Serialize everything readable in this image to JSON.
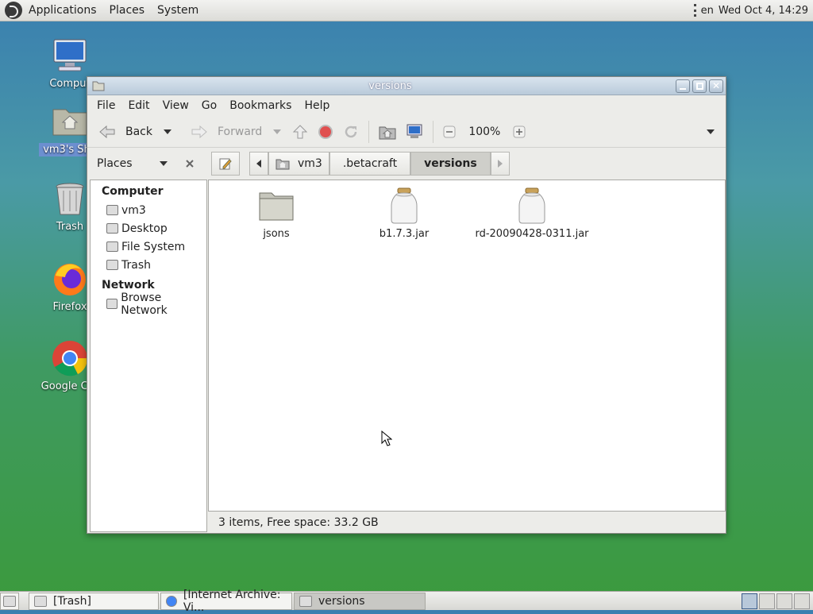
{
  "top_panel": {
    "menus": [
      "Applications",
      "Places",
      "System"
    ],
    "language": "en",
    "clock": "Wed Oct 4, 14:29"
  },
  "desktop": {
    "icons": [
      {
        "label": "Comput",
        "icon": "computer-icon"
      },
      {
        "label": "vm3's Sha",
        "icon": "home-folder-icon",
        "selected": true
      },
      {
        "label": "Trash",
        "icon": "trash-icon"
      },
      {
        "label": "Firefox",
        "icon": "firefox-icon"
      },
      {
        "label": "Google Chr",
        "icon": "chrome-icon"
      }
    ]
  },
  "window": {
    "title": "versions",
    "menus": [
      "File",
      "Edit",
      "View",
      "Go",
      "Bookmarks",
      "Help"
    ],
    "toolbar": {
      "back": "Back",
      "forward": "Forward",
      "zoom": "100%"
    },
    "sidebar": {
      "selector": "Places",
      "categories": [
        {
          "title": "Computer",
          "items": [
            "vm3",
            "Desktop",
            "File System",
            "Trash"
          ]
        },
        {
          "title": "Network",
          "items": [
            "Browse Network"
          ]
        }
      ]
    },
    "breadcrumbs": [
      "vm3",
      ".betacraft",
      "versions"
    ],
    "files": [
      {
        "name": "jsons",
        "type": "folder"
      },
      {
        "name": "b1.7.3.jar",
        "type": "jar"
      },
      {
        "name": "rd-20090428-0311.jar",
        "type": "jar"
      }
    ],
    "status": "3 items, Free space: 33.2 GB"
  },
  "bottom_panel": {
    "tasks": [
      "[Trash]",
      "[Internet Archive: Vi...",
      "versions"
    ],
    "workspaces": 4,
    "active_workspace": 1
  }
}
